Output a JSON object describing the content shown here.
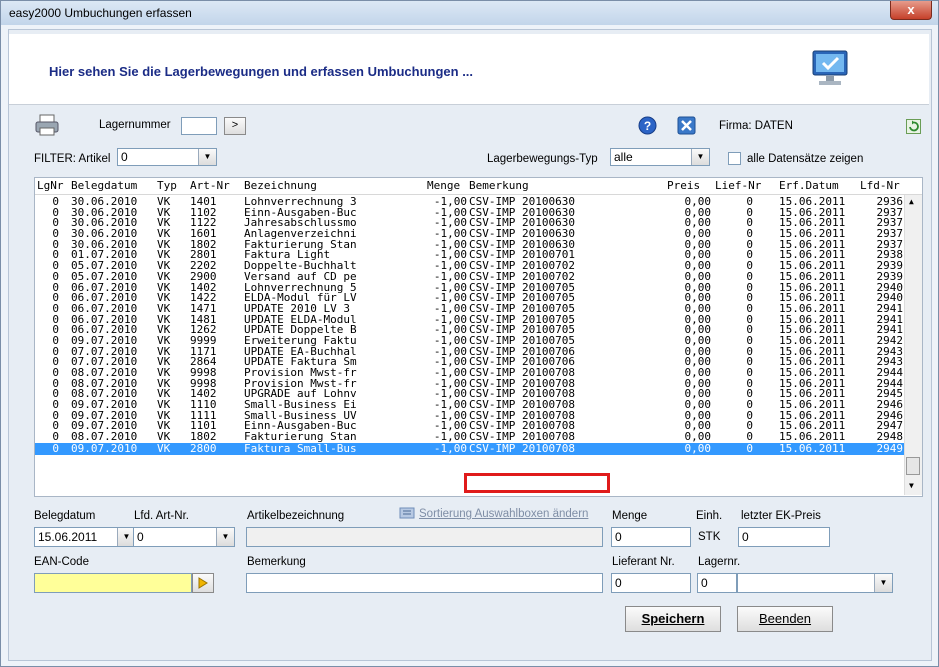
{
  "window": {
    "title": "easy2000 Umbuchungen erfassen",
    "close_glyph": "x"
  },
  "header": {
    "text": "Hier sehen Sie die Lagerbewegungen und erfassen Umbuchungen ..."
  },
  "toolbar": {
    "lagernummer_label": "Lagernummer",
    "lagernummer_value": "",
    "go_glyph": ">",
    "firma_label": "Firma: DATEN"
  },
  "filter": {
    "artikel_label": "FILTER: Artikel",
    "artikel_value": "0",
    "typ_label": "Lagerbewegungs-Typ",
    "typ_value": "alle",
    "all_records_label": "alle Datensätze zeigen"
  },
  "table": {
    "columns": [
      "LgNr",
      "Belegdatum",
      "Typ",
      "Art-Nr",
      "Bezeichnung",
      "Menge",
      "Bemerkung",
      "Preis",
      "Lief-Nr",
      "Erf.Datum",
      "Lfd-Nr"
    ],
    "rows": [
      [
        "0",
        "30.06.2010",
        "VK",
        "1401",
        "Lohnverrechnung 3",
        "-1,00",
        "CSV-IMP 20100630",
        "0,00",
        "0",
        "15.06.2011",
        "2936"
      ],
      [
        "0",
        "30.06.2010",
        "VK",
        "1102",
        "Einn-Ausgaben-Buc",
        "-1,00",
        "CSV-IMP 20100630",
        "0,00",
        "0",
        "15.06.2011",
        "2937"
      ],
      [
        "0",
        "30.06.2010",
        "VK",
        "1122",
        "Jahresabschlussmo",
        "-1,00",
        "CSV-IMP 20100630",
        "0,00",
        "0",
        "15.06.2011",
        "2937"
      ],
      [
        "0",
        "30.06.2010",
        "VK",
        "1601",
        "Anlagenverzeichni",
        "-1,00",
        "CSV-IMP 20100630",
        "0,00",
        "0",
        "15.06.2011",
        "2937"
      ],
      [
        "0",
        "30.06.2010",
        "VK",
        "1802",
        "Fakturierung Stan",
        "-1,00",
        "CSV-IMP 20100630",
        "0,00",
        "0",
        "15.06.2011",
        "2937"
      ],
      [
        "0",
        "01.07.2010",
        "VK",
        "2801",
        "Faktura Light",
        "-1,00",
        "CSV-IMP 20100701",
        "0,00",
        "0",
        "15.06.2011",
        "2938"
      ],
      [
        "0",
        "05.07.2010",
        "VK",
        "2202",
        "Doppelte-Buchhalt",
        "-1,00",
        "CSV-IMP 20100702",
        "0,00",
        "0",
        "15.06.2011",
        "2939"
      ],
      [
        "0",
        "05.07.2010",
        "VK",
        "2900",
        "Versand auf CD pe",
        "-1,00",
        "CSV-IMP 20100702",
        "0,00",
        "0",
        "15.06.2011",
        "2939"
      ],
      [
        "0",
        "06.07.2010",
        "VK",
        "1402",
        "Lohnverrechnung 5",
        "-1,00",
        "CSV-IMP 20100705",
        "0,00",
        "0",
        "15.06.2011",
        "2940"
      ],
      [
        "0",
        "06.07.2010",
        "VK",
        "1422",
        "ELDA-Modul für LV",
        "-1,00",
        "CSV-IMP 20100705",
        "0,00",
        "0",
        "15.06.2011",
        "2940"
      ],
      [
        "0",
        "06.07.2010",
        "VK",
        "1471",
        "UPDATE 2010 LV 3",
        "-1,00",
        "CSV-IMP 20100705",
        "0,00",
        "0",
        "15.06.2011",
        "2941"
      ],
      [
        "0",
        "06.07.2010",
        "VK",
        "1481",
        "UPDATE ELDA-Modul",
        "-1,00",
        "CSV-IMP 20100705",
        "0,00",
        "0",
        "15.06.2011",
        "2941"
      ],
      [
        "0",
        "06.07.2010",
        "VK",
        "1262",
        "UPDATE Doppelte B",
        "-1,00",
        "CSV-IMP 20100705",
        "0,00",
        "0",
        "15.06.2011",
        "2941"
      ],
      [
        "0",
        "09.07.2010",
        "VK",
        "9999",
        "Erweiterung Faktu",
        "-1,00",
        "CSV-IMP 20100705",
        "0,00",
        "0",
        "15.06.2011",
        "2942"
      ],
      [
        "0",
        "07.07.2010",
        "VK",
        "1171",
        "UPDATE EA-Buchhal",
        "-1,00",
        "CSV-IMP 20100706",
        "0,00",
        "0",
        "15.06.2011",
        "2943"
      ],
      [
        "0",
        "07.07.2010",
        "VK",
        "2864",
        "UPDATE Faktura Sm",
        "-1,00",
        "CSV-IMP 20100706",
        "0,00",
        "0",
        "15.06.2011",
        "2943"
      ],
      [
        "0",
        "08.07.2010",
        "VK",
        "9998",
        "Provision Mwst-fr",
        "-1,00",
        "CSV-IMP 20100708",
        "0,00",
        "0",
        "15.06.2011",
        "2944"
      ],
      [
        "0",
        "08.07.2010",
        "VK",
        "9998",
        "Provision Mwst-fr",
        "-1,00",
        "CSV-IMP 20100708",
        "0,00",
        "0",
        "15.06.2011",
        "2944"
      ],
      [
        "0",
        "08.07.2010",
        "VK",
        "1402",
        "UPGRADE auf Lohnv",
        "-1,00",
        "CSV-IMP 20100708",
        "0,00",
        "0",
        "15.06.2011",
        "2945"
      ],
      [
        "0",
        "09.07.2010",
        "VK",
        "1110",
        "Small-Business Ei",
        "-1,00",
        "CSV-IMP 20100708",
        "0,00",
        "0",
        "15.06.2011",
        "2946"
      ],
      [
        "0",
        "09.07.2010",
        "VK",
        "1111",
        "Small-Business UV",
        "-1,00",
        "CSV-IMP 20100708",
        "0,00",
        "0",
        "15.06.2011",
        "2946"
      ],
      [
        "0",
        "09.07.2010",
        "VK",
        "1101",
        "Einn-Ausgaben-Buc",
        "-1,00",
        "CSV-IMP 20100708",
        "0,00",
        "0",
        "15.06.2011",
        "2947"
      ],
      [
        "0",
        "08.07.2010",
        "VK",
        "1802",
        "Fakturierung Stan",
        "-1,00",
        "CSV-IMP 20100708",
        "0,00",
        "0",
        "15.06.2011",
        "2948"
      ],
      [
        "0",
        "09.07.2010",
        "VK",
        "2800",
        "Faktura Small-Bus",
        "-1,00",
        "CSV-IMP 20100708",
        "0,00",
        "0",
        "15.06.2011",
        "2949"
      ]
    ],
    "selected_row": 23
  },
  "form": {
    "belegdatum_label": "Belegdatum",
    "belegdatum_value": "15.06.2011",
    "lfd_art_label": "Lfd. Art-Nr.",
    "lfd_art_value": "0",
    "artikelbez_label": "Artikelbezeichnung",
    "artikelbez_value": "",
    "sort_link": "Sortierung Auswahlboxen ändern",
    "menge_label": "Menge",
    "menge_value": "0",
    "einh_label": "Einh.",
    "einh_value": "STK",
    "ek_label": "letzter EK-Preis",
    "ek_value": "0",
    "ean_label": "EAN-Code",
    "ean_value": "",
    "bemerkung_label": "Bemerkung",
    "bemerkung_value": "",
    "lieferant_label": "Lieferant Nr.",
    "lieferant_value": "0",
    "lagernr_label": "Lagernr.",
    "lagernr_value": "0",
    "lagernr_select": ""
  },
  "buttons": {
    "save": "Speichern",
    "close": "Beenden"
  },
  "colors": {
    "accent": "#3399ff",
    "header_text": "#1b2c86",
    "highlight": "#e01b1b",
    "ean_bg": "#ffff99"
  }
}
